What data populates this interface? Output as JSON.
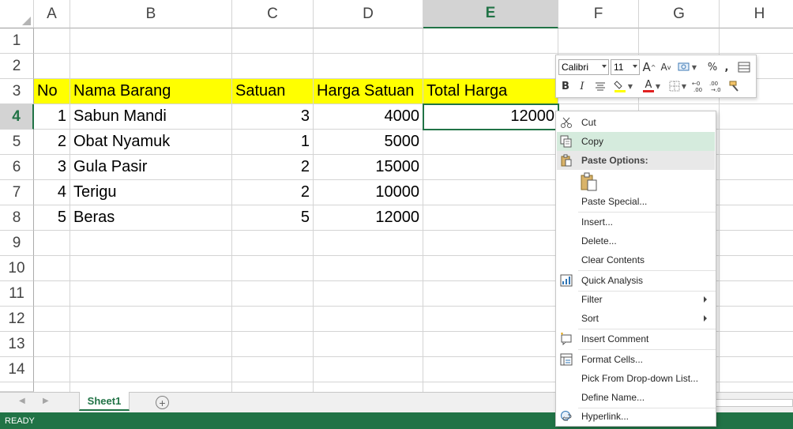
{
  "spreadsheet": {
    "columns": [
      "A",
      "B",
      "C",
      "D",
      "E",
      "F",
      "G",
      "H"
    ],
    "rows": [
      "1",
      "2",
      "3",
      "4",
      "5",
      "6",
      "7",
      "8",
      "9",
      "10",
      "11",
      "12",
      "13",
      "14"
    ],
    "selected_column": "E",
    "selected_row": "4",
    "header_row": {
      "no": "No",
      "nama_barang": "Nama Barang",
      "satuan": "Satuan",
      "harga_satuan": "Harga Satuan",
      "total_harga": "Total Harga"
    },
    "items": [
      {
        "no": "1",
        "nama": "Sabun Mandi",
        "satuan": "3",
        "harga": "4000",
        "total": "12000"
      },
      {
        "no": "2",
        "nama": "Obat Nyamuk",
        "satuan": "1",
        "harga": "5000",
        "total": ""
      },
      {
        "no": "3",
        "nama": "Gula Pasir",
        "satuan": "2",
        "harga": "15000",
        "total": ""
      },
      {
        "no": "4",
        "nama": "Terigu",
        "satuan": "2",
        "harga": "10000",
        "total": ""
      },
      {
        "no": "5",
        "nama": "Beras",
        "satuan": "5",
        "harga": "12000",
        "total": ""
      }
    ],
    "header_fill_color": "#ffff00",
    "accent_color": "#217346"
  },
  "sheet_tabs": {
    "active": "Sheet1",
    "add_icon": "plus-circle-icon"
  },
  "status_bar": {
    "text": "READY"
  },
  "mini_toolbar": {
    "font_name": "Calibri",
    "font_size": "11",
    "buttons": {
      "increase_font": "A",
      "decrease_font": "A",
      "percent": "%",
      "comma": ",",
      "bold": "B",
      "italic": "I",
      "font_color": "A"
    }
  },
  "context_menu": {
    "items": {
      "cut": "Cut",
      "copy": "Copy",
      "paste_options": "Paste Options:",
      "paste_special": "Paste Special...",
      "insert": "Insert...",
      "delete": "Delete...",
      "clear_contents": "Clear Contents",
      "quick_analysis": "Quick Analysis",
      "filter": "Filter",
      "sort": "Sort",
      "insert_comment": "Insert Comment",
      "format_cells": "Format Cells...",
      "pick_dropdown": "Pick From Drop-down List...",
      "define_name": "Define Name...",
      "hyperlink": "Hyperlink..."
    },
    "hovered_item": "Copy"
  }
}
